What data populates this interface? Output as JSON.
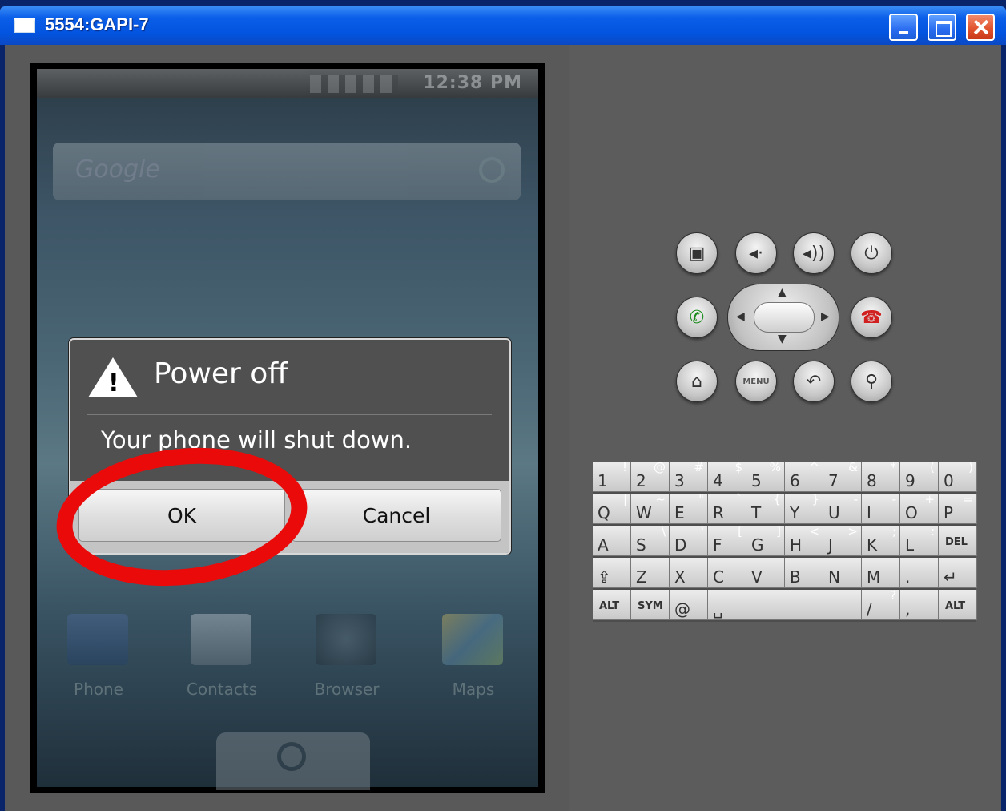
{
  "window": {
    "title": "5554:GAPI-7",
    "controls": {
      "minimize": "minimize-button",
      "maximize": "maximize-button",
      "close": "close-button"
    }
  },
  "phone": {
    "status_time": "12:38 PM",
    "search_placeholder": "Google",
    "dock": [
      "Phone",
      "Contacts",
      "Browser",
      "Maps"
    ]
  },
  "dialog": {
    "title": "Power off",
    "message": "Your phone will shut down.",
    "ok_label": "OK",
    "cancel_label": "Cancel"
  },
  "hardware_buttons": {
    "menu_label": "MENU",
    "icons": [
      "camera-icon",
      "volume-down-icon",
      "volume-up-icon",
      "power-icon",
      "call-icon",
      "end-call-icon",
      "home-icon",
      "menu-icon",
      "back-icon",
      "search-icon"
    ]
  },
  "keyboard": {
    "rows": [
      [
        {
          "p": "1",
          "s": "!"
        },
        {
          "p": "2",
          "s": "@"
        },
        {
          "p": "3",
          "s": "#"
        },
        {
          "p": "4",
          "s": "$"
        },
        {
          "p": "5",
          "s": "%"
        },
        {
          "p": "6",
          "s": "^"
        },
        {
          "p": "7",
          "s": "&"
        },
        {
          "p": "8",
          "s": "*"
        },
        {
          "p": "9",
          "s": "("
        },
        {
          "p": "0",
          "s": ")"
        }
      ],
      [
        {
          "p": "Q",
          "s": "|"
        },
        {
          "p": "W",
          "s": "~"
        },
        {
          "p": "E",
          "s": "\""
        },
        {
          "p": "R",
          "s": "`"
        },
        {
          "p": "T",
          "s": "{"
        },
        {
          "p": "Y",
          "s": "}"
        },
        {
          "p": "U",
          "s": "-"
        },
        {
          "p": "I",
          "s": "-"
        },
        {
          "p": "O",
          "s": "+"
        },
        {
          "p": "P",
          "s": "="
        }
      ],
      [
        {
          "p": "A",
          "s": ""
        },
        {
          "p": "S",
          "s": "\\"
        },
        {
          "p": "D",
          "s": "'"
        },
        {
          "p": "F",
          "s": "["
        },
        {
          "p": "G",
          "s": "]"
        },
        {
          "p": "H",
          "s": "<"
        },
        {
          "p": "J",
          "s": ">"
        },
        {
          "p": "K",
          "s": ";"
        },
        {
          "p": "L",
          "s": ":"
        },
        {
          "p": "DEL",
          "s": ""
        }
      ],
      [
        {
          "p": "⇪",
          "s": ""
        },
        {
          "p": "Z",
          "s": ""
        },
        {
          "p": "X",
          "s": ""
        },
        {
          "p": "C",
          "s": ""
        },
        {
          "p": "V",
          "s": ""
        },
        {
          "p": "B",
          "s": ""
        },
        {
          "p": "N",
          "s": ""
        },
        {
          "p": "M",
          "s": ""
        },
        {
          "p": ".",
          "s": ""
        },
        {
          "p": "↵",
          "s": ""
        }
      ],
      [
        {
          "p": "ALT",
          "s": ""
        },
        {
          "p": "SYM",
          "s": ""
        },
        {
          "p": "@",
          "s": ""
        },
        {
          "p": "␣",
          "s": ""
        },
        {
          "p": "/",
          "s": "?"
        },
        {
          "p": ",",
          "s": ""
        },
        {
          "p": "ALT",
          "s": ""
        }
      ]
    ]
  },
  "annotation": {
    "color": "#ea0a0a"
  }
}
